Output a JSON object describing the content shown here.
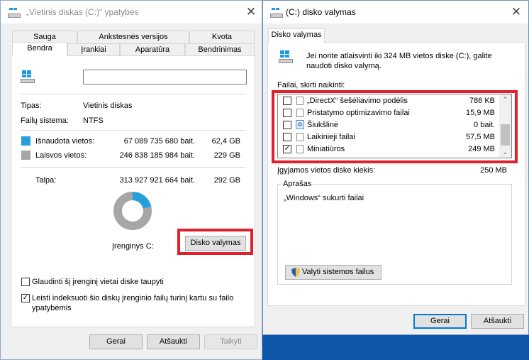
{
  "colors": {
    "accent": "#0078d7",
    "used": "#26a0da",
    "free": "#a6a6a6",
    "highlight": "#e0202a"
  },
  "left_window": {
    "title": "„Vietinis diskas (C:)“ ypatybės",
    "tabs_row1": [
      "Sauga",
      "Ankstesnės versijos",
      "Kvota"
    ],
    "tabs_row2": [
      "Bendra",
      "Įrankiai",
      "Aparatūra",
      "Bendrinimas"
    ],
    "name_value": "",
    "type_label": "Tipas:",
    "type_value": "Vietinis diskas",
    "fs_label": "Failų sistema:",
    "fs_value": "NTFS",
    "used_label": "Išnaudota vietos:",
    "used_bytes": "67 089 735 680 bait.",
    "used_gb": "62,4 GB",
    "free_label": "Laisvos vietos:",
    "free_bytes": "246 838 185 984 bait.",
    "free_gb": "229 GB",
    "capacity_label": "Talpa:",
    "capacity_bytes": "313 927 921 664 bait.",
    "capacity_gb": "292 GB",
    "used_fraction": 0.214,
    "drive_label": "Įrenginys C:",
    "cleanup_button": "Disko valymas",
    "compress_label": "Glaudinti šį įrenginį vietai diske taupyti",
    "compress_checked": false,
    "index_label": "Leisti indeksuoti šio diskų įrenginio failų turinį kartu su failo ypatybėmis",
    "index_checked": true,
    "ok": "Gerai",
    "cancel": "Atšaukti",
    "apply": "Taikyti"
  },
  "right_window": {
    "title": "(C:) disko valymas",
    "tab": "Disko valymas",
    "intro": "Jei norite atlaisvinti iki 324 MB vietos diske  (C:), galite naudoti disko valymą.",
    "files_label": "Failai, skirti naikinti:",
    "files": [
      {
        "name": "„DirectX“ šešėliavimo podėlis",
        "size": "786 KB",
        "checked": false,
        "icon": "file-icon"
      },
      {
        "name": "Pristatymo optimizavimo failai",
        "size": "15,9 MB",
        "checked": false,
        "icon": "file-icon"
      },
      {
        "name": "Šiukšlinė",
        "size": "0 bait.",
        "checked": false,
        "icon": "recycle-bin-icon"
      },
      {
        "name": "Laikinieji failai",
        "size": "57,5 MB",
        "checked": false,
        "icon": "file-icon"
      },
      {
        "name": "Miniatiūros",
        "size": "249 MB",
        "checked": true,
        "icon": "file-icon"
      }
    ],
    "gain_label": "Įgyjamos vietos diske kiekis:",
    "gain_value": "250 MB",
    "description_label": "Aprašas",
    "description_text": "„Windows“ sukurti failai",
    "system_files_button": "Valyti sistemos failus",
    "ok": "Gerai",
    "cancel": "Atšaukti"
  }
}
